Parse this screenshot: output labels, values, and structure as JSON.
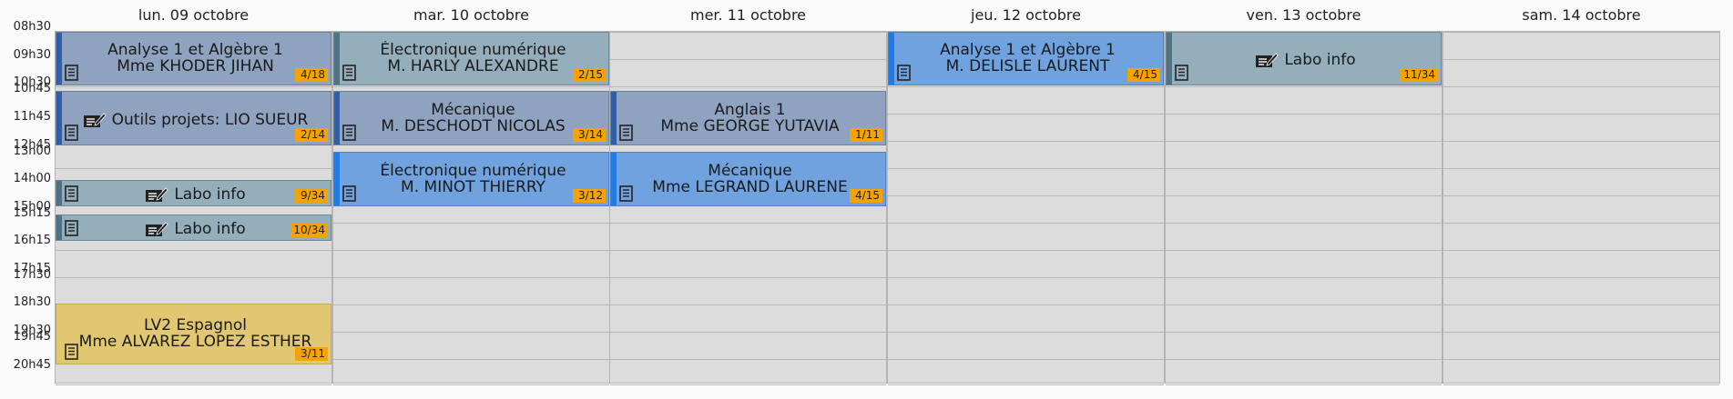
{
  "calendar": {
    "days": [
      {
        "label": "lun. 09 octobre"
      },
      {
        "label": "mar. 10 octobre"
      },
      {
        "label": "mer. 11 octobre"
      },
      {
        "label": "jeu. 12 octobre"
      },
      {
        "label": "ven. 13 octobre"
      },
      {
        "label": "sam. 14 octobre"
      }
    ],
    "time_labels": [
      "08h30",
      "09h30",
      "10h30",
      "10h45",
      "11h45",
      "12h45",
      "13h00",
      "14h00",
      "15h00",
      "15h15",
      "16h15",
      "17h15",
      "17h30",
      "18h30",
      "19h30",
      "19h45",
      "20h45"
    ],
    "events": [
      {
        "day": 0,
        "start": "08h30",
        "end": "10h30",
        "title": "Analyse 1 et Algèbre 1",
        "teacher": "Mme KHODER JIHAN",
        "count": "4/18",
        "style": "slate",
        "icon": "document-icon"
      },
      {
        "day": 0,
        "start": "10h45",
        "end": "12h45",
        "title": "Outils projets: LIO SUEUR",
        "teacher": "",
        "count": "2/14",
        "style": "slate",
        "icon": "document-icon",
        "title_icon": "edit-note-icon"
      },
      {
        "day": 0,
        "start": "14h00",
        "end": "15h00",
        "title": "Labo info",
        "teacher": "",
        "count": "9/34",
        "style": "teal",
        "icon": "document-icon",
        "title_icon": "edit-note-icon"
      },
      {
        "day": 0,
        "start": "15h15",
        "end": "16h15",
        "title": "Labo info",
        "teacher": "",
        "count": "10/34",
        "style": "teal",
        "icon": "document-icon",
        "title_icon": "edit-note-icon"
      },
      {
        "day": 0,
        "start": "18h30",
        "end": "20h45",
        "title": "LV2 Espagnol",
        "teacher": "Mme ALVAREZ LOPEZ ESTHER",
        "count": "3/11",
        "style": "yellow",
        "icon": "document-icon"
      },
      {
        "day": 1,
        "start": "08h30",
        "end": "10h30",
        "title": "Électronique numérique",
        "teacher": "M. HARLY ALEXANDRE",
        "count": "2/15",
        "style": "teal",
        "icon": "document-icon"
      },
      {
        "day": 1,
        "start": "10h45",
        "end": "12h45",
        "title": "Mécanique",
        "teacher": "M. DESCHODT NICOLAS",
        "count": "3/14",
        "style": "slate",
        "icon": "document-icon"
      },
      {
        "day": 1,
        "start": "13h00",
        "end": "15h00",
        "title": "Électronique numérique",
        "teacher": "M. MINOT THIERRY",
        "count": "3/12",
        "style": "blue",
        "icon": "document-icon"
      },
      {
        "day": 2,
        "start": "10h45",
        "end": "12h45",
        "title": "Anglais 1",
        "teacher": "Mme GEORGE YUTAVIA",
        "count": "1/11",
        "style": "slate",
        "icon": "document-icon"
      },
      {
        "day": 2,
        "start": "13h00",
        "end": "15h00",
        "title": "Mécanique",
        "teacher": "Mme LEGRAND LAURENE",
        "count": "4/15",
        "style": "blue",
        "icon": "document-icon"
      },
      {
        "day": 3,
        "start": "08h30",
        "end": "10h30",
        "title": "Analyse 1 et Algèbre 1",
        "teacher": "M. DELISLE LAURENT",
        "count": "4/15",
        "style": "blue",
        "icon": "document-icon"
      },
      {
        "day": 4,
        "start": "08h30",
        "end": "10h30",
        "title": "Labo info",
        "teacher": "",
        "count": "11/34",
        "style": "teal",
        "icon": "document-icon",
        "title_icon": "edit-note-icon"
      }
    ],
    "styles": {
      "slate": {
        "bg": "#8fa3c1",
        "bar": "#2f5fa8",
        "border": "#6d7f99"
      },
      "teal": {
        "bg": "#94aebb",
        "bar": "#4f7384",
        "border": "#6d8795"
      },
      "blue": {
        "bg": "#6fa2de",
        "bar": "#1f7be6",
        "border": "#4a82c9"
      },
      "yellow": {
        "bg": "#e1c771",
        "bar": "#e1c771",
        "border": "#c7ad52"
      }
    },
    "badge_color": "#f6a300"
  }
}
